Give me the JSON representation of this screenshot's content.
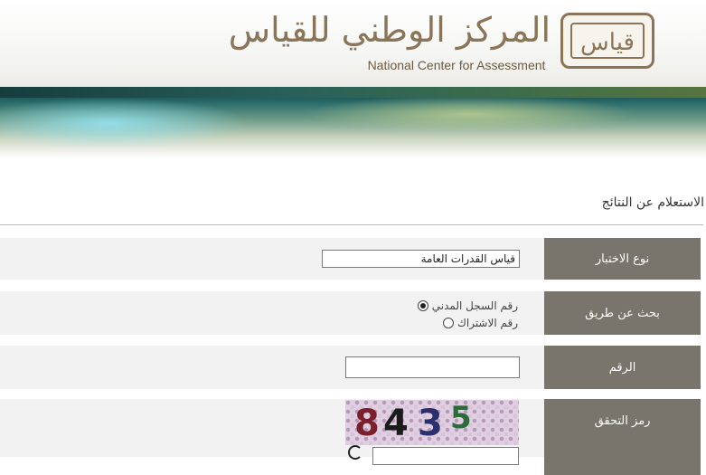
{
  "header": {
    "logo_arabic": "المركز الوطني للقياس",
    "logo_english": "National Center for Assessment",
    "logo_mark_text": "قياس"
  },
  "page": {
    "title": "الاستعلام عن النتائج"
  },
  "form": {
    "exam_type": {
      "label": "نوع الاختبار",
      "value": "قياس القدرات العامة"
    },
    "search_by": {
      "label": "بحث عن طريق",
      "options": [
        {
          "label": "رقم السجل المدني",
          "checked": true
        },
        {
          "label": "رقم الاشتراك",
          "checked": false
        }
      ]
    },
    "number": {
      "label": "الرقم",
      "value": ""
    },
    "captcha": {
      "label": "رمز التحقق",
      "digits": [
        {
          "char": "8",
          "color": "#7a1f2b"
        },
        {
          "char": "4",
          "color": "#1b1b1b"
        },
        {
          "char": "3",
          "color": "#2c2f6e"
        },
        {
          "char": "5",
          "color": "#2e6b3a"
        }
      ],
      "input_value": ""
    }
  },
  "colors": {
    "label_bg": "#7a756c",
    "row_bg": "#f2f2f2",
    "brand": "#8a7558"
  },
  "icons": {
    "refresh": "refresh-icon",
    "radio_selected": "radio-selected-icon",
    "radio_empty": "radio-empty-icon"
  }
}
